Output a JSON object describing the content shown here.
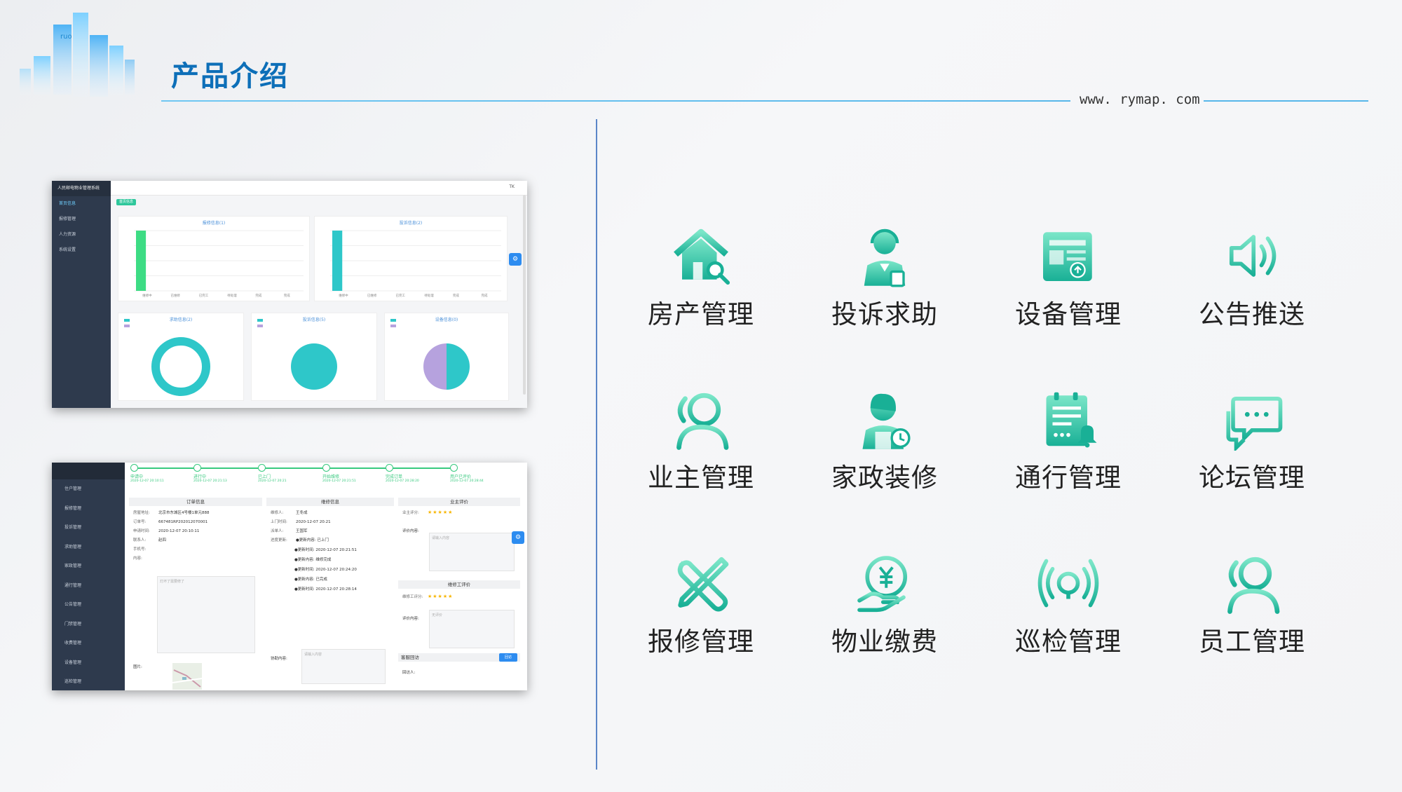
{
  "header": {
    "title": "产品介绍",
    "site_url": "www. rymap. com"
  },
  "colors": {
    "title_blue": "#0d6fb8",
    "accent_line": "#57b7ea",
    "icon_green_light": "#6fe0c0",
    "icon_green_dark": "#1fb59a",
    "sidebar_dark": "#2e3a4d"
  },
  "screenshot_dashboard": {
    "brand": "人民邮电物业管理系统",
    "menu": [
      "首页信息",
      "报修管理",
      "人力资源",
      "系统设置"
    ],
    "topbar_user": "TK",
    "tag": "首页信息",
    "charts": [
      {
        "title": "报修信息(1)",
        "type": "bar",
        "categories": [
          "维修中",
          "已维修",
          "已完工",
          "待处理",
          "完成",
          "完成"
        ],
        "values": [
          1,
          0,
          0,
          0,
          0,
          0
        ]
      },
      {
        "title": "投诉信息(2)",
        "type": "bar",
        "categories": [
          "维修中",
          "已维修",
          "已完工",
          "待处理",
          "完成",
          "完成"
        ],
        "values": [
          2,
          0,
          0,
          0,
          0,
          0
        ]
      },
      {
        "title": "求助信息(2)",
        "type": "pie",
        "legend": [
          "已处理",
          "未处理"
        ]
      },
      {
        "title": "投诉信息(5)",
        "type": "pie",
        "legend": [
          "已处理",
          "未处理"
        ]
      },
      {
        "title": "设备信息(0)",
        "type": "pie",
        "legend": [
          "正常",
          "损坏"
        ]
      }
    ]
  },
  "screenshot_order": {
    "menu": [
      "住户管理",
      "报修管理",
      "投诉管理",
      "求助管理",
      "家政管理",
      "通行管理",
      "公告管理",
      "门禁管理",
      "收费管理",
      "设备管理",
      "巡检管理"
    ],
    "steps": [
      {
        "label": "申请中",
        "time": "2020-12-07 20:10:11"
      },
      {
        "label": "进行中",
        "time": "2020-12-07 20:21:13"
      },
      {
        "label": "已上门",
        "time": "2020-12-07 20:21"
      },
      {
        "label": "开始维修",
        "time": "2020-12-07 20:21:51"
      },
      {
        "label": "完成订单",
        "time": "2020-12-07 20:28:20"
      },
      {
        "label": "用户已评价",
        "time": "2020-12-07 20:28:44"
      }
    ],
    "order_info": {
      "heading": "订单信息",
      "rows": [
        {
          "k": "房屋地址:",
          "v": "北京市东城区4号楼1单元888"
        },
        {
          "k": "订单号:",
          "v": "667481RP202012070001"
        },
        {
          "k": "申请时间:",
          "v": "2020-12-07 20:10:11"
        },
        {
          "k": "联系人:",
          "v": "赵四"
        },
        {
          "k": "手机号:",
          "v": ""
        },
        {
          "k": "内容:",
          "v": ""
        }
      ],
      "content_placeholder": "灯坏了需要修了",
      "image_label": "图片:"
    },
    "repair_info": {
      "heading": "维修信息",
      "rows": [
        {
          "k": "维修人:",
          "v": "王冬成"
        },
        {
          "k": "上门时间:",
          "v": "2020-12-07 20:21"
        },
        {
          "k": "派单人:",
          "v": "王国军"
        },
        {
          "k": "进度更新:",
          "v": "●更新内容: 已上门"
        }
      ],
      "progress": [
        "●更新时间: 2020-12-07 20:21:51",
        "●更新内容: 维修完成",
        "●更新时间: 2020-12-07 20:24:20",
        "●更新内容: 已完成",
        "●更新时间: 2020-12-07 20:28:14"
      ],
      "remark_label": "协助内容:",
      "remark_placeholder": "请输入内容"
    },
    "evaluation": {
      "heading": "业主评价",
      "rating_label": "业主评分:",
      "rating": 5,
      "content_label": "评价内容:",
      "content_placeholder": "请输入内容",
      "worker_heading": "维修工评价",
      "worker_rating_label": "维修工评分:",
      "worker_rating": 5,
      "worker_content_label": "评价内容:",
      "worker_placeholder": "无评价",
      "callback_label": "客服回访",
      "callback_button": "回访",
      "visitor_label": "回访人:"
    }
  },
  "features": [
    {
      "label": "房产管理",
      "icon": "house-search-icon"
    },
    {
      "label": "投诉求助",
      "icon": "customer-service-icon"
    },
    {
      "label": "设备管理",
      "icon": "device-panel-icon"
    },
    {
      "label": "公告推送",
      "icon": "speaker-icon"
    },
    {
      "label": "业主管理",
      "icon": "owner-user-icon"
    },
    {
      "label": "家政装修",
      "icon": "housekeeper-icon"
    },
    {
      "label": "通行管理",
      "icon": "notepad-bell-icon"
    },
    {
      "label": "论坛管理",
      "icon": "chat-bubbles-icon"
    },
    {
      "label": "报修管理",
      "icon": "wrench-screwdriver-icon"
    },
    {
      "label": "物业缴费",
      "icon": "yuan-payment-icon"
    },
    {
      "label": "巡检管理",
      "icon": "signal-broadcast-icon"
    },
    {
      "label": "员工管理",
      "icon": "staff-user-icon"
    }
  ]
}
